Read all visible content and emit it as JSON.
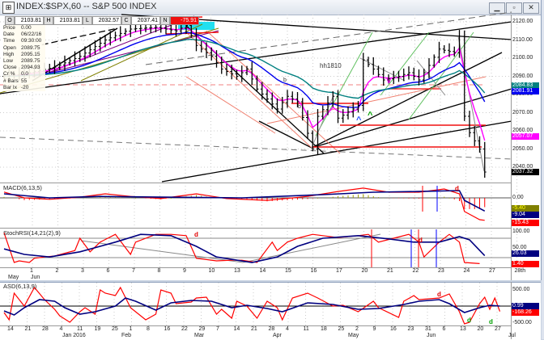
{
  "window": {
    "title": "INDEX:$SPX,60 -- S&P 500 INDEX",
    "buttons": [
      "minimize",
      "restore",
      "close"
    ]
  },
  "ohlc_bar": {
    "O": "2103.81",
    "H": "2103.81",
    "L": "2032.57",
    "C": "2037.41",
    "N": "-75.91"
  },
  "info": [
    {
      "k": "Price",
      "v": "0.00"
    },
    {
      "k": "Date",
      "v": "06/22/16"
    },
    {
      "k": "Time",
      "v": "09:30:00"
    },
    {
      "k": "Open",
      "v": "2089.75"
    },
    {
      "k": "High",
      "v": "2095.15"
    },
    {
      "k": "Low",
      "v": "2089.75"
    },
    {
      "k": "Close",
      "v": "2094.93"
    },
    {
      "k": "Cr %",
      "v": "0.0"
    },
    {
      "k": "# Bars",
      "v": "55"
    },
    {
      "k": "Bar Ix",
      "v": "-20"
    }
  ],
  "price_axis": {
    "ticks": [
      "2120.00",
      "2110.00",
      "2100.00",
      "2090.00",
      "2080.00",
      "2070.00",
      "2060.00",
      "2050.00",
      "2040.00"
    ],
    "tags": [
      {
        "v": "2084.83",
        "c": "#008080"
      },
      {
        "v": "2081.91",
        "c": "#0000ee"
      },
      {
        "v": "2057.07",
        "c": "#ff00ff"
      },
      {
        "v": "2037.32",
        "c": "#000000"
      }
    ]
  },
  "annotations": {
    "hh": "hh1810",
    "b1": "b",
    "b2": "b",
    "v": "V",
    "up_blue": "^",
    "up_green": "^",
    "d_stoch1": "d",
    "d_stoch2": "d",
    "d_macd": "d",
    "d_asd_red": "d",
    "d_asd_g1": "d",
    "d_asd_g2": "d"
  },
  "macd": {
    "label": "MACD(6,13,5)",
    "zero": "0.00",
    "tags": [
      {
        "v": "-5.40",
        "c": "#808000"
      },
      {
        "v": "-9.04",
        "c": "#000080"
      },
      {
        "v": "-15.43",
        "c": "#ff0000"
      }
    ]
  },
  "stoch": {
    "label": "StochRSI(14,21(2),9)",
    "ticks": [
      "100.00",
      "50.00"
    ],
    "tags": [
      {
        "v": "26.03",
        "c": "#000080"
      },
      {
        "v": "1.40",
        "c": "#ff0000"
      }
    ]
  },
  "time_axis": {
    "month1": "May",
    "month2": "Jun",
    "days": [
      "1",
      "2",
      "3",
      "6",
      "7",
      "8",
      "9",
      "10",
      "13",
      "14",
      "15",
      "16",
      "17",
      "20",
      "21",
      "22",
      "23",
      "24",
      "27",
      "28th"
    ]
  },
  "asd": {
    "label": "ASD(6,13,9)",
    "ticks": [
      "500.00",
      "-500.00"
    ],
    "tags": [
      {
        "v": "0.99",
        "c": "#000080"
      },
      {
        "v": "-168.26",
        "c": "#ff0000"
      }
    ],
    "days": [
      "14",
      "21",
      "28",
      "4",
      "11",
      "19",
      "25",
      "1",
      "8",
      "16",
      "22",
      "29",
      "7",
      "14",
      "21",
      "28",
      "4",
      "11",
      "18",
      "25",
      "2",
      "9",
      "16",
      "23",
      "31",
      "6",
      "13",
      "20",
      "27"
    ],
    "months": [
      "Jan 2016",
      "Feb",
      "Mar",
      "Apr",
      "May",
      "Jun",
      "Jul"
    ]
  },
  "chart_data": {
    "type": "line",
    "title": "INDEX:$SPX,60 -- S&P 500 INDEX",
    "ylim": [
      2030,
      2124
    ],
    "price_waypoints": [
      [
        0,
        2090
      ],
      [
        5,
        2092
      ],
      [
        10,
        2095
      ],
      [
        15,
        2101
      ],
      [
        20,
        2110
      ],
      [
        25,
        2116
      ],
      [
        30,
        2117
      ],
      [
        34,
        2115
      ],
      [
        36,
        2118
      ],
      [
        38,
        2107
      ],
      [
        41,
        2101
      ],
      [
        43,
        2094
      ],
      [
        46,
        2090
      ],
      [
        48,
        2094
      ],
      [
        50,
        2083
      ],
      [
        54,
        2072
      ],
      [
        56,
        2079
      ],
      [
        58,
        2076
      ],
      [
        61,
        2050
      ],
      [
        62,
        2068
      ],
      [
        65,
        2079
      ],
      [
        66,
        2067
      ],
      [
        69,
        2072
      ],
      [
        70,
        2074
      ],
      [
        71,
        2099
      ],
      [
        73,
        2094
      ],
      [
        75,
        2088
      ],
      [
        78,
        2090
      ],
      [
        80,
        2092
      ],
      [
        82,
        2088
      ],
      [
        84,
        2096
      ],
      [
        86,
        2105
      ],
      [
        89,
        2103
      ],
      [
        90,
        2112
      ],
      [
        91,
        2068
      ],
      [
        92,
        2059
      ],
      [
        94,
        2050
      ],
      [
        95,
        2037.32
      ]
    ],
    "macd_line": [
      [
        0,
        4
      ],
      [
        4,
        0
      ],
      [
        9,
        -1
      ],
      [
        15,
        0.5
      ],
      [
        20,
        2.8
      ],
      [
        25,
        1
      ],
      [
        31,
        -0.5
      ],
      [
        38,
        2.8
      ],
      [
        44,
        -0.5
      ],
      [
        52,
        -1.7
      ],
      [
        60,
        1
      ],
      [
        66,
        4.4
      ],
      [
        71,
        6.7
      ],
      [
        76,
        3.9
      ],
      [
        82,
        3.9
      ],
      [
        87,
        6.1
      ],
      [
        90,
        2.8
      ],
      [
        91,
        -9.4
      ],
      [
        94,
        -15
      ],
      [
        95,
        -15.43
      ]
    ],
    "macd_signal": [
      [
        0,
        2.8
      ],
      [
        9,
        0
      ],
      [
        19,
        1
      ],
      [
        31,
        0.5
      ],
      [
        47,
        0
      ],
      [
        63,
        2.2
      ],
      [
        73,
        3.9
      ],
      [
        82,
        4.4
      ],
      [
        90,
        5
      ],
      [
        91,
        -1.7
      ],
      [
        95,
        -9.04
      ]
    ],
    "stoch_k": [
      [
        0,
        97
      ],
      [
        2,
        5
      ],
      [
        3,
        10
      ],
      [
        5,
        5
      ],
      [
        6,
        18
      ],
      [
        8,
        22
      ],
      [
        10,
        25
      ],
      [
        14,
        42
      ],
      [
        15,
        80
      ],
      [
        17,
        38
      ],
      [
        19,
        68
      ],
      [
        22,
        92
      ],
      [
        25,
        30
      ],
      [
        26,
        68
      ],
      [
        30,
        92
      ],
      [
        33,
        92
      ],
      [
        36,
        88
      ],
      [
        38,
        18
      ],
      [
        42,
        10
      ],
      [
        45,
        12
      ],
      [
        47,
        12
      ],
      [
        50,
        5
      ],
      [
        53,
        68
      ],
      [
        54,
        42
      ],
      [
        56,
        68
      ],
      [
        58,
        80
      ],
      [
        61,
        92
      ],
      [
        63,
        88
      ],
      [
        66,
        82
      ],
      [
        70,
        88
      ],
      [
        72,
        92
      ],
      [
        74,
        68
      ],
      [
        77,
        80
      ],
      [
        80,
        92
      ],
      [
        82,
        68
      ],
      [
        83,
        22
      ],
      [
        86,
        68
      ],
      [
        88,
        92
      ],
      [
        90,
        68
      ],
      [
        91,
        5
      ],
      [
        94,
        1.4
      ]
    ],
    "stoch_d": [
      [
        0,
        47
      ],
      [
        4,
        30
      ],
      [
        9,
        22
      ],
      [
        15,
        38
      ],
      [
        22,
        68
      ],
      [
        27,
        92
      ],
      [
        33,
        88
      ],
      [
        38,
        55
      ],
      [
        42,
        22
      ],
      [
        49,
        5
      ],
      [
        54,
        22
      ],
      [
        58,
        55
      ],
      [
        63,
        80
      ],
      [
        70,
        88
      ],
      [
        76,
        78
      ],
      [
        81,
        68
      ],
      [
        86,
        68
      ],
      [
        90,
        85
      ],
      [
        92,
        75
      ],
      [
        95,
        26.03
      ]
    ],
    "asd_line": [
      [
        0,
        -200
      ],
      [
        1,
        -425
      ],
      [
        2,
        400
      ],
      [
        4,
        0
      ],
      [
        6,
        575
      ],
      [
        8,
        200
      ],
      [
        10,
        -100
      ],
      [
        11,
        -300
      ],
      [
        13,
        -500
      ],
      [
        15,
        -175
      ],
      [
        16,
        -50
      ],
      [
        18,
        -250
      ],
      [
        19,
        500
      ],
      [
        20,
        400
      ],
      [
        22,
        325
      ],
      [
        23,
        575
      ],
      [
        25,
        -50
      ],
      [
        26,
        -175
      ],
      [
        28,
        -425
      ],
      [
        30,
        -250
      ],
      [
        31,
        500
      ],
      [
        33,
        400
      ],
      [
        34,
        75
      ],
      [
        37,
        125
      ],
      [
        38,
        250
      ],
      [
        40,
        275
      ],
      [
        42,
        -250
      ],
      [
        43,
        -100
      ],
      [
        45,
        -375
      ],
      [
        46,
        150
      ],
      [
        48,
        0
      ],
      [
        50,
        -375
      ],
      [
        52,
        150
      ],
      [
        54,
        -50
      ],
      [
        55,
        -425
      ],
      [
        57,
        250
      ],
      [
        60,
        400
      ],
      [
        62,
        250
      ],
      [
        65,
        0
      ],
      [
        67,
        25
      ],
      [
        70,
        -175
      ],
      [
        73,
        150
      ],
      [
        74,
        -50
      ],
      [
        78,
        -350
      ],
      [
        79,
        150
      ],
      [
        81,
        325
      ],
      [
        82,
        200
      ],
      [
        86,
        250
      ],
      [
        88,
        375
      ],
      [
        90,
        -175
      ],
      [
        91,
        -550
      ],
      [
        92,
        -500
      ],
      [
        94,
        75
      ],
      [
        95,
        275
      ],
      [
        96,
        -100
      ],
      [
        97,
        250
      ],
      [
        98,
        -168.26
      ]
    ],
    "asd_signal": [
      [
        0,
        -150
      ],
      [
        2,
        -275
      ],
      [
        4,
        -50
      ],
      [
        7,
        200
      ],
      [
        10,
        150
      ],
      [
        12,
        -50
      ],
      [
        15,
        -250
      ],
      [
        18,
        -175
      ],
      [
        22,
        0
      ],
      [
        24,
        250
      ],
      [
        26,
        150
      ],
      [
        30,
        -125
      ],
      [
        33,
        100
      ],
      [
        37,
        175
      ],
      [
        41,
        150
      ],
      [
        45,
        -50
      ],
      [
        48,
        25
      ],
      [
        52,
        -75
      ],
      [
        55,
        -175
      ],
      [
        60,
        100
      ],
      [
        65,
        50
      ],
      [
        70,
        -100
      ],
      [
        74,
        -75
      ],
      [
        79,
        50
      ],
      [
        82,
        150
      ],
      [
        86,
        200
      ],
      [
        88,
        75
      ],
      [
        91,
        -200
      ],
      [
        94,
        -50
      ],
      [
        96,
        25
      ],
      [
        98,
        0.99
      ]
    ]
  }
}
